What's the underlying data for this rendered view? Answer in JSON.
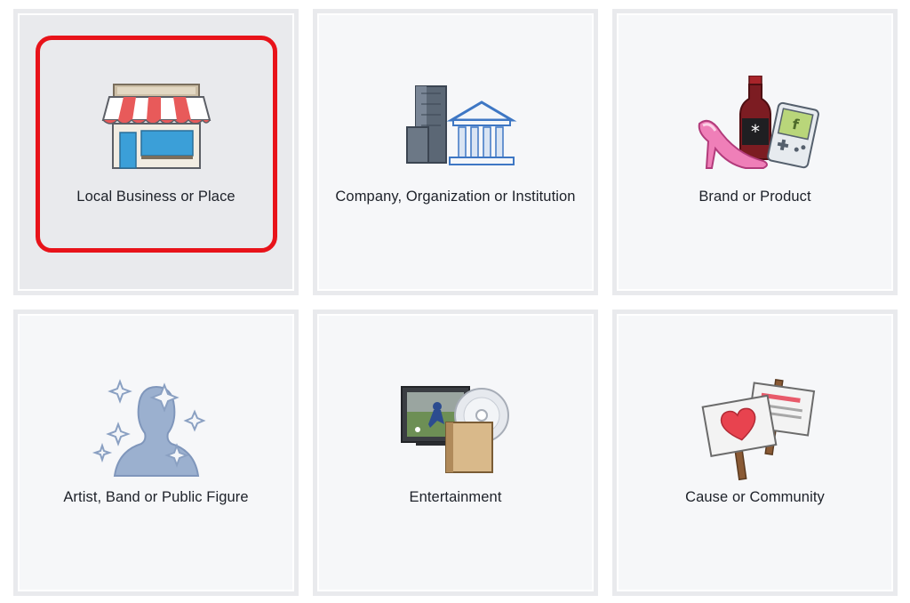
{
  "categories": [
    {
      "label": "Local Business or Place",
      "icon": "storefront-icon",
      "selected": true
    },
    {
      "label": "Company, Organization or Institution",
      "icon": "office-building-icon",
      "selected": false
    },
    {
      "label": "Brand or Product",
      "icon": "brand-products-icon",
      "selected": false
    },
    {
      "label": "Artist, Band or Public Figure",
      "icon": "public-figure-silhouette-icon",
      "selected": false
    },
    {
      "label": "Entertainment",
      "icon": "tv-dvd-book-icon",
      "selected": false
    },
    {
      "label": "Cause or Community",
      "icon": "protest-signs-icon",
      "selected": false
    }
  ],
  "colors": {
    "card_bg": "#f6f7f9",
    "card_selected_bg": "#e9eaed",
    "card_border": "#e9eaed",
    "highlight_ring": "#e8131a",
    "label_text": "#1d2129"
  }
}
